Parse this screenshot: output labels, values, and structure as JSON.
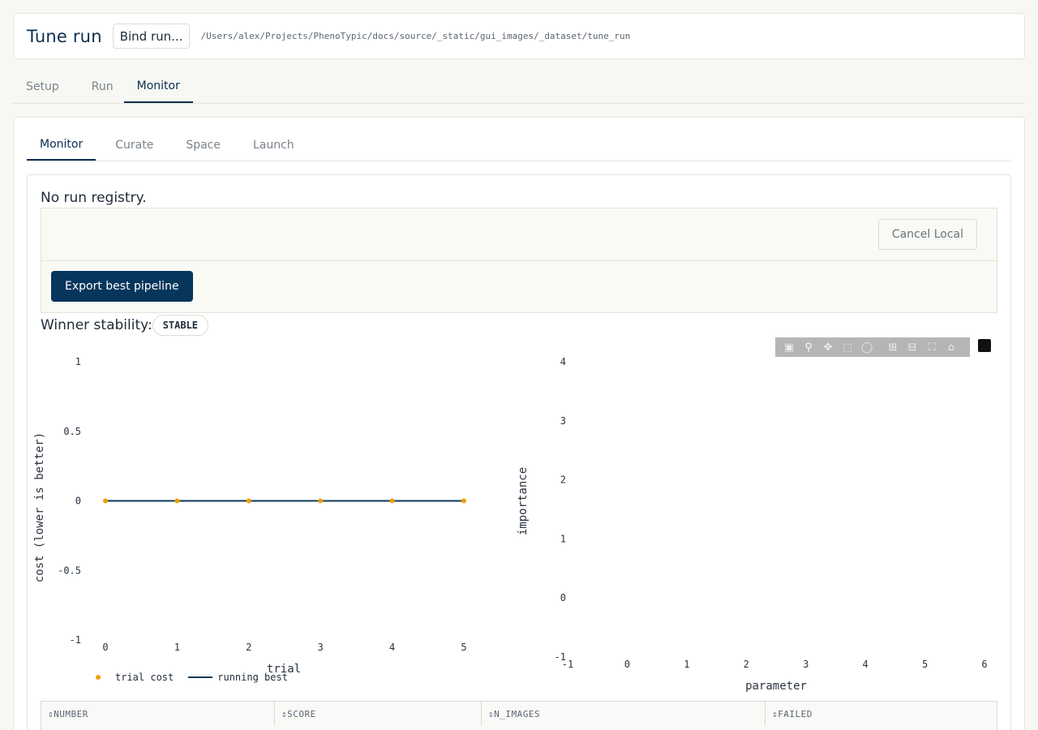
{
  "header": {
    "title": "Tune run",
    "bind_label": "Bind run...",
    "path": "/Users/alex/Projects/PhenoTypic/docs/source/_static/gui_images/_dataset/tune_run"
  },
  "top_tabs": [
    {
      "label": "Setup"
    },
    {
      "label": "Run"
    },
    {
      "label": "Monitor"
    }
  ],
  "inner_tabs": [
    {
      "label": "Monitor"
    },
    {
      "label": "Curate"
    },
    {
      "label": "Space"
    },
    {
      "label": "Launch"
    }
  ],
  "status_message": "No run registry.",
  "cancel_label": "Cancel Local",
  "export_label": "Export best pipeline",
  "stability": {
    "label": "Winner stability:",
    "badge": "STABLE"
  },
  "modebar_icons": [
    "camera-icon",
    "zoom-icon",
    "pan-icon",
    "box-select-icon",
    "lasso-icon",
    "zoom-in-icon",
    "zoom-out-icon",
    "autoscale-icon",
    "home-icon",
    "plotly-logo-icon"
  ],
  "chart_data": [
    {
      "type": "line",
      "xlabel": "trial",
      "ylabel": "cost (lower is better)",
      "x": [
        0,
        1,
        2,
        3,
        4,
        5
      ],
      "xticks": [
        "0",
        "1",
        "2",
        "3",
        "4",
        "5"
      ],
      "yticks": [
        "1",
        "0.5",
        "0",
        "-0.5",
        "-1"
      ],
      "ylim": [
        -1,
        1
      ],
      "series": [
        {
          "name": "trial cost",
          "mode": "markers",
          "color": "#f0a000",
          "values": [
            0,
            0,
            0,
            0,
            0,
            0
          ]
        },
        {
          "name": "running best",
          "mode": "line",
          "color": "#0b3a5c",
          "values": [
            0,
            0,
            0,
            0,
            0,
            0
          ]
        }
      ],
      "legend": "bottom-left"
    },
    {
      "type": "bar",
      "xlabel": "parameter",
      "ylabel": "importance",
      "xticks": [
        "-1",
        "0",
        "1",
        "2",
        "3",
        "4",
        "5",
        "6"
      ],
      "yticks": [
        "4",
        "3",
        "2",
        "1",
        "0",
        "-1"
      ],
      "xlim": [
        -1,
        6
      ],
      "ylim": [
        -1,
        4
      ],
      "values": []
    }
  ],
  "table": {
    "columns": [
      {
        "label": "⇕NUMBER"
      },
      {
        "label": "⇕SCORE"
      },
      {
        "label": "⇕N_IMAGES"
      },
      {
        "label": "⇕FAILED"
      }
    ]
  }
}
